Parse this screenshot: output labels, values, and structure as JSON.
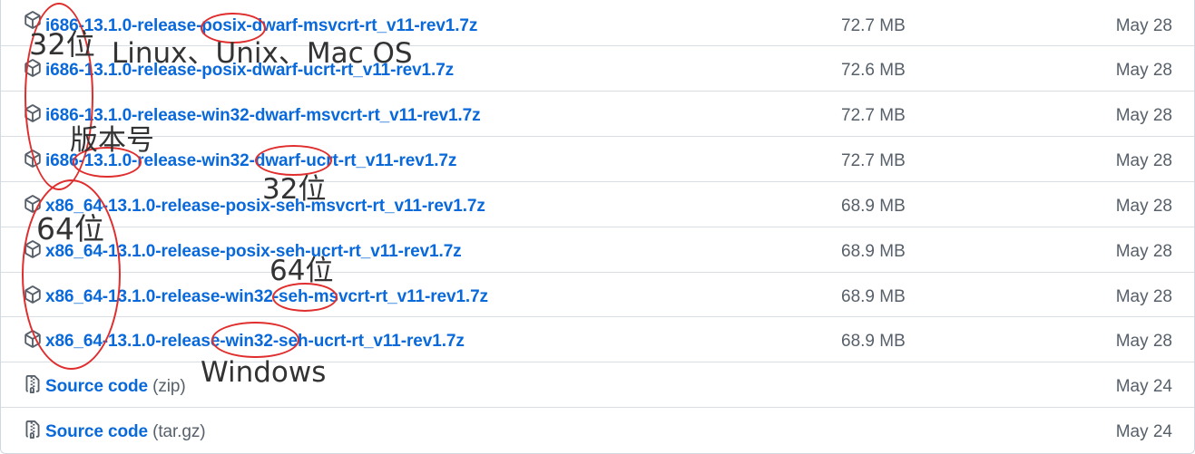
{
  "assets": [
    {
      "name": "i686-13.1.0-release-posix-dwarf-msvcrt-rt_v11-rev1.7z",
      "suffix": "",
      "size": "72.7 MB",
      "date": "May 28",
      "icon": "package-icon"
    },
    {
      "name": "i686-13.1.0-release-posix-dwarf-ucrt-rt_v11-rev1.7z",
      "suffix": "",
      "size": "72.6 MB",
      "date": "May 28",
      "icon": "package-icon"
    },
    {
      "name": "i686-13.1.0-release-win32-dwarf-msvcrt-rt_v11-rev1.7z",
      "suffix": "",
      "size": "72.7 MB",
      "date": "May 28",
      "icon": "package-icon"
    },
    {
      "name": "i686-13.1.0-release-win32-dwarf-ucrt-rt_v11-rev1.7z",
      "suffix": "",
      "size": "72.7 MB",
      "date": "May 28",
      "icon": "package-icon"
    },
    {
      "name": "x86_64-13.1.0-release-posix-seh-msvcrt-rt_v11-rev1.7z",
      "suffix": "",
      "size": "68.9 MB",
      "date": "May 28",
      "icon": "package-icon"
    },
    {
      "name": "x86_64-13.1.0-release-posix-seh-ucrt-rt_v11-rev1.7z",
      "suffix": "",
      "size": "68.9 MB",
      "date": "May 28",
      "icon": "package-icon"
    },
    {
      "name": "x86_64-13.1.0-release-win32-seh-msvcrt-rt_v11-rev1.7z",
      "suffix": "",
      "size": "68.9 MB",
      "date": "May 28",
      "icon": "package-icon"
    },
    {
      "name": "x86_64-13.1.0-release-win32-seh-ucrt-rt_v11-rev1.7z",
      "suffix": "",
      "size": "68.9 MB",
      "date": "May 28",
      "icon": "package-icon"
    },
    {
      "name": "Source code",
      "suffix": "(zip)",
      "size": "",
      "date": "May 24",
      "icon": "file-zip-icon"
    },
    {
      "name": "Source code",
      "suffix": "(tar.gz)",
      "size": "",
      "date": "May 24",
      "icon": "file-zip-icon"
    }
  ],
  "annotations": {
    "bit32_top": "32位",
    "platforms": "Linux、Unix、Mac OS",
    "version": "版本号",
    "bit32_mid": "32位",
    "bit64_left": "64位",
    "bit64_mid": "64位",
    "windows": "Windows",
    "color": "#e02d2d"
  }
}
